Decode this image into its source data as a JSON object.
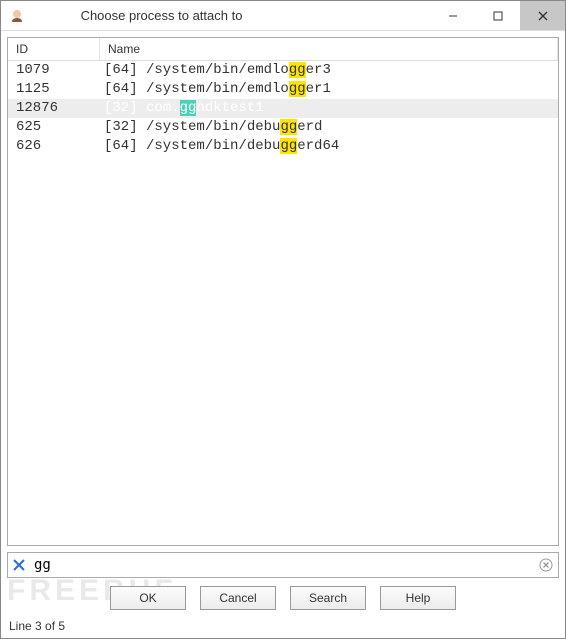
{
  "window": {
    "title": "Choose process to attach to"
  },
  "columns": {
    "id": "ID",
    "name": "Name"
  },
  "rows": [
    {
      "id": "1079",
      "arch": "[64]",
      "pre": "/system/bin/emdlo",
      "hl": "gg",
      "post": "er3",
      "selected": false
    },
    {
      "id": "1125",
      "arch": "[64]",
      "pre": "/system/bin/emdlo",
      "hl": "gg",
      "post": "er1",
      "selected": false
    },
    {
      "id": "12876",
      "arch": "[32]",
      "pre": "com.",
      "hl": "gg",
      "post": "ndktest1",
      "selected": true
    },
    {
      "id": "625",
      "arch": "[32]",
      "pre": "/system/bin/debu",
      "hl": "gg",
      "post": "erd",
      "selected": false
    },
    {
      "id": "626",
      "arch": "[64]",
      "pre": "/system/bin/debu",
      "hl": "gg",
      "post": "erd64",
      "selected": false
    }
  ],
  "search": {
    "value": "gg"
  },
  "buttons": {
    "ok": "OK",
    "cancel": "Cancel",
    "search": "Search",
    "help": "Help"
  },
  "status": "Line 3 of 5",
  "watermark": "FREEBUF"
}
